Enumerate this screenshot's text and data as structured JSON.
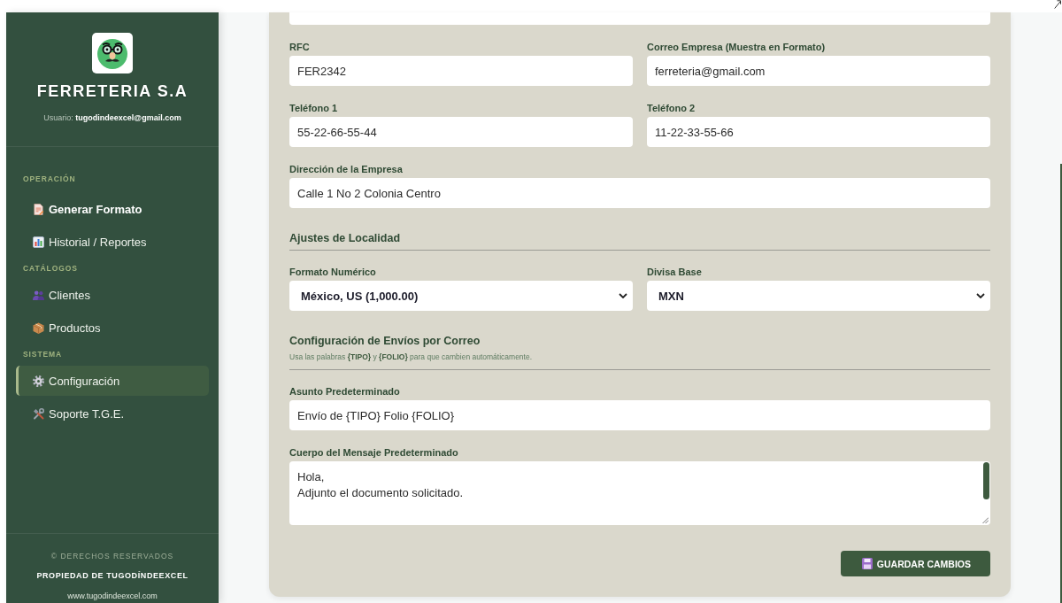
{
  "sidebar": {
    "brand": "FERRETERIA S.A",
    "user": "Usuario: **tugodindeexcel@gmail.com**",
    "sections": [
      {
        "title": "OPERACIÓN",
        "items": [
          {
            "label": "Generar Formato",
            "selected": false,
            "highlighted": true
          },
          {
            "label": "Historial / Reportes",
            "selected": false,
            "highlighted": false
          }
        ]
      },
      {
        "title": "CATÁLOGOS",
        "items": [
          {
            "label": "Clientes",
            "selected": false,
            "highlighted": false
          },
          {
            "label": "Productos",
            "selected": false,
            "highlighted": false
          }
        ]
      },
      {
        "title": "SISTEMA",
        "items": [
          {
            "label": "Configuración",
            "selected": true,
            "highlighted": false
          },
          {
            "label": "Soporte T.G.E.",
            "selected": false,
            "highlighted": false
          }
        ]
      }
    ],
    "footer": {
      "rights": "© DERECHOS RESERVADOS",
      "owner": "PROPIEDAD DE TUGODÍNDEEXCEL",
      "website": "www.tugodindeexcel.com"
    }
  },
  "form": {
    "rows": [
      {
        "kind": "clipped_field"
      },
      {
        "kind": "fields",
        "fields": [
          {
            "kind": "input",
            "label": "RFC",
            "value": "FER2342"
          },
          {
            "kind": "input",
            "label": "Correo Empresa (Muestra en Formato)",
            "value": "ferreteria@gmail.com"
          }
        ]
      },
      {
        "kind": "fields",
        "fields": [
          {
            "kind": "input",
            "label": "Teléfono 1",
            "value": "55-22-66-55-44"
          },
          {
            "kind": "input",
            "label": "Teléfono 2",
            "value": "11-22-33-55-66"
          }
        ]
      },
      {
        "kind": "fields",
        "fields": [
          {
            "kind": "input",
            "label": "Dirección de la Empresa",
            "value": "Calle 1 No 2 Colonia Centro"
          }
        ]
      },
      {
        "kind": "heading",
        "title": "Ajustes de Localidad"
      },
      {
        "kind": "fields",
        "fields": [
          {
            "kind": "select",
            "label": "Formato Numérico",
            "value": "México, US (1,000.00)"
          },
          {
            "kind": "select",
            "label": "Divisa Base",
            "value": "MXN"
          }
        ]
      },
      {
        "kind": "heading",
        "title": "Configuración de Envíos por Correo",
        "note": "Usa las palabras **{TIPO}** y **{FOLIO}** para que cambien automáticamente."
      },
      {
        "kind": "fields",
        "fields": [
          {
            "kind": "input",
            "label": "Asunto Predeterminado",
            "value": "Envío de {TIPO} Folio {FOLIO}"
          }
        ]
      },
      {
        "kind": "fields",
        "fields": [
          {
            "kind": "textarea",
            "label": "Cuerpo del Mensaje Predeterminado",
            "value": "Hola,\nAdjunto el documento solicitado."
          }
        ]
      }
    ],
    "save_button": "GUARDAR CAMBIOS"
  }
}
